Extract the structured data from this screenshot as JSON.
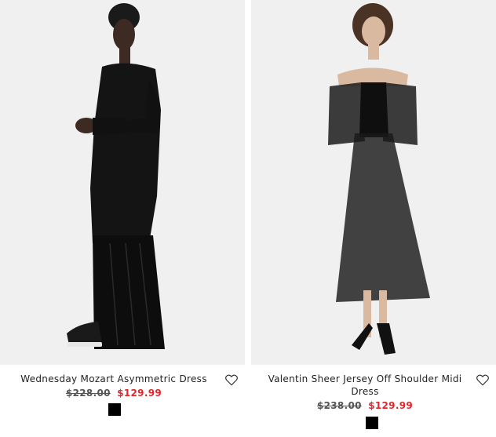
{
  "products": [
    {
      "name": "Wednesday Mozart Asymmetric Dress",
      "price_old": "$228.00",
      "price_new": "$129.99",
      "swatch_color": "#000000",
      "wishlist_icon": "heart-outline-icon"
    },
    {
      "name": "Valentin Sheer Jersey Off Shoulder Midi Dress",
      "price_old": "$238.00",
      "price_new": "$129.99",
      "swatch_color": "#000000",
      "wishlist_icon": "heart-outline-icon"
    }
  ],
  "colors": {
    "background": "#ffffff",
    "photo_bg": "#f0f0f0",
    "sale_price": "#e0262c",
    "text": "#222222"
  }
}
